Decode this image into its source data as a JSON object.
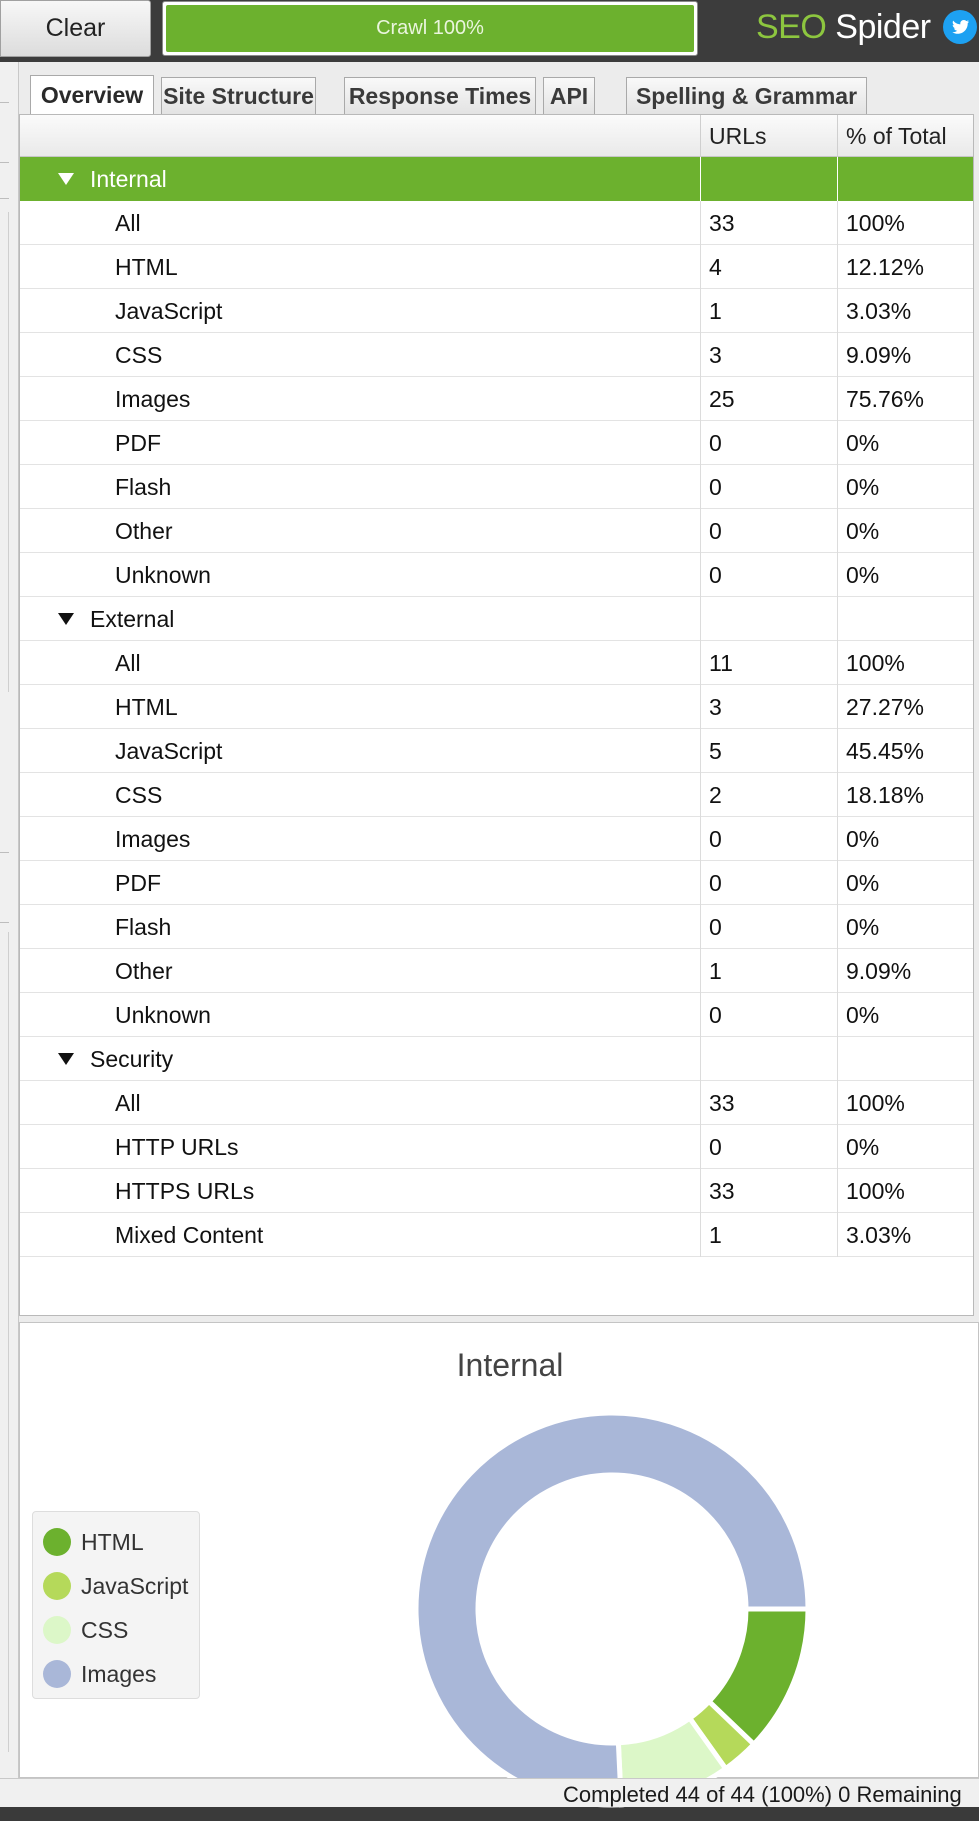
{
  "toolbar": {
    "clear_label": "Clear",
    "crawl_progress_label": "Crawl 100%",
    "crawl_progress": 1.0,
    "brand_seo": "SEO",
    "brand_spider": "Spider"
  },
  "tabs": [
    {
      "label": "Overview",
      "active": true
    },
    {
      "label": "Site Structure",
      "active": false
    },
    {
      "label": "Response Times",
      "active": false
    },
    {
      "label": "API",
      "active": false
    },
    {
      "label": "Spelling & Grammar",
      "active": false
    }
  ],
  "table": {
    "columns": [
      "",
      "URLs",
      "% of Total"
    ],
    "rows": [
      {
        "kind": "group",
        "label": "Internal",
        "urls": "",
        "pct": "",
        "selected": true
      },
      {
        "kind": "item",
        "label": "All",
        "urls": "33",
        "pct": "100%"
      },
      {
        "kind": "item",
        "label": "HTML",
        "urls": "4",
        "pct": "12.12%"
      },
      {
        "kind": "item",
        "label": "JavaScript",
        "urls": "1",
        "pct": "3.03%"
      },
      {
        "kind": "item",
        "label": "CSS",
        "urls": "3",
        "pct": "9.09%"
      },
      {
        "kind": "item",
        "label": "Images",
        "urls": "25",
        "pct": "75.76%"
      },
      {
        "kind": "item",
        "label": "PDF",
        "urls": "0",
        "pct": "0%"
      },
      {
        "kind": "item",
        "label": "Flash",
        "urls": "0",
        "pct": "0%"
      },
      {
        "kind": "item",
        "label": "Other",
        "urls": "0",
        "pct": "0%"
      },
      {
        "kind": "item",
        "label": "Unknown",
        "urls": "0",
        "pct": "0%"
      },
      {
        "kind": "group",
        "label": "External",
        "urls": "",
        "pct": ""
      },
      {
        "kind": "item",
        "label": "All",
        "urls": "11",
        "pct": "100%"
      },
      {
        "kind": "item",
        "label": "HTML",
        "urls": "3",
        "pct": "27.27%"
      },
      {
        "kind": "item",
        "label": "JavaScript",
        "urls": "5",
        "pct": "45.45%"
      },
      {
        "kind": "item",
        "label": "CSS",
        "urls": "2",
        "pct": "18.18%"
      },
      {
        "kind": "item",
        "label": "Images",
        "urls": "0",
        "pct": "0%"
      },
      {
        "kind": "item",
        "label": "PDF",
        "urls": "0",
        "pct": "0%"
      },
      {
        "kind": "item",
        "label": "Flash",
        "urls": "0",
        "pct": "0%"
      },
      {
        "kind": "item",
        "label": "Other",
        "urls": "1",
        "pct": "9.09%"
      },
      {
        "kind": "item",
        "label": "Unknown",
        "urls": "0",
        "pct": "0%"
      },
      {
        "kind": "group",
        "label": "Security",
        "urls": "",
        "pct": ""
      },
      {
        "kind": "item",
        "label": "All",
        "urls": "33",
        "pct": "100%"
      },
      {
        "kind": "item",
        "label": "HTTP URLs",
        "urls": "0",
        "pct": "0%"
      },
      {
        "kind": "item",
        "label": "HTTPS URLs",
        "urls": "33",
        "pct": "100%"
      },
      {
        "kind": "item",
        "label": "Mixed Content",
        "urls": "1",
        "pct": "3.03%"
      }
    ]
  },
  "chart_data": {
    "type": "pie",
    "title": "Internal",
    "legend_position": "left",
    "categories": [
      "HTML",
      "JavaScript",
      "CSS",
      "Images"
    ],
    "values": [
      4,
      1,
      3,
      25
    ],
    "colors": [
      "#6cb12e",
      "#b5d95a",
      "#dcf7c8",
      "#a9b7d8"
    ]
  },
  "status": {
    "text": "Completed 44 of 44 (100%) 0 Remaining"
  },
  "colors": {
    "accent": "#6cb12e",
    "brand_green": "#8dc63f",
    "twitter": "#1da1f2"
  },
  "icons": {
    "twitter": "twitter-icon",
    "expand": "triangle-down-icon"
  }
}
